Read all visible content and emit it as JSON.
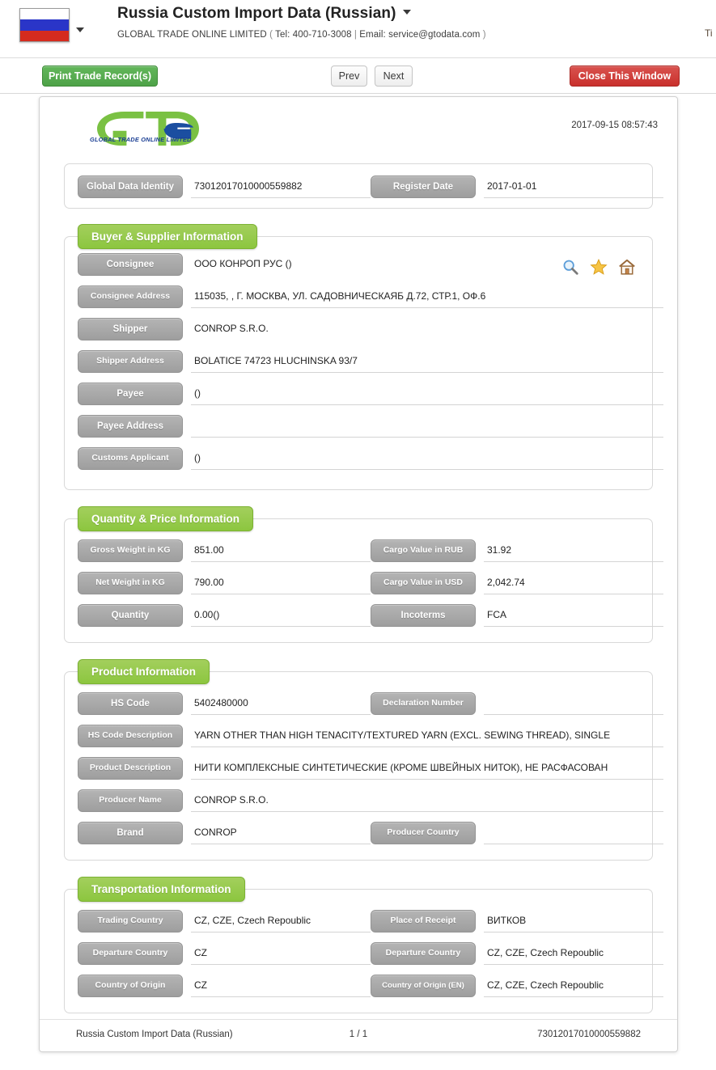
{
  "header": {
    "flag_icon": "russia-flag-icon",
    "title": "Russia Custom Import Data (Russian)",
    "company_name": "GLOBAL TRADE ONLINE LIMITED",
    "company_contact_open": "(",
    "tel_label": "Tel: 400-710-3008",
    "contact_sep": "|",
    "email_label": "Email: service@gtodata.com",
    "company_contact_close": ")",
    "clipped_right_text": "Ti"
  },
  "toolbar": {
    "print_label": "Print Trade Record(s)",
    "prev_label": "Prev",
    "next_label": "Next",
    "close_label": "Close This Window"
  },
  "document": {
    "logo_text": "GTO",
    "logo_subtitle": "GLOBAL TRADE  ONLINE LIMITED",
    "timestamp": "2017-09-15 08:57:43",
    "identity": {
      "global_data_identity_label": "Global Data Identity",
      "global_data_identity_value": "73012017010000559882",
      "register_date_label": "Register Date",
      "register_date_value": "2017-01-01"
    },
    "buyer_supplier": {
      "section_title": "Buyer & Supplier Information",
      "icons": [
        "search-icon",
        "favorite-star-icon",
        "home-icon"
      ],
      "fields": [
        {
          "label": "Consignee",
          "value": "OOO КОНРОП РУС ()"
        },
        {
          "label": "Consignee Address",
          "value": "115035, , Г. МОСКВА, УЛ. САДОВНИЧЕСКАЯБ Д.72, СТР.1, ОФ.6"
        },
        {
          "label": "Shipper",
          "value": "CONROP S.R.O."
        },
        {
          "label": "Shipper Address",
          "value": "BOLATICE 74723 HLUCHINSKA 93/7"
        },
        {
          "label": "Payee",
          "value": "()"
        },
        {
          "label": "Payee Address",
          "value": ""
        },
        {
          "label": "Customs Applicant",
          "value": "()"
        }
      ]
    },
    "quantity_price": {
      "section_title": "Quantity & Price Information",
      "left_fields": [
        {
          "label": "Gross Weight in KG",
          "value": "851.00"
        },
        {
          "label": "Net Weight in KG",
          "value": "790.00"
        },
        {
          "label": "Quantity",
          "value": "0.00()"
        }
      ],
      "right_fields": [
        {
          "label": "Cargo Value in RUB",
          "value": "31.92"
        },
        {
          "label": "Cargo Value in USD",
          "value": "2,042.74"
        },
        {
          "label": "Incoterms",
          "value": "FCA"
        }
      ]
    },
    "product": {
      "section_title": "Product Information",
      "hs_code_label": "HS Code",
      "hs_code_value": "5402480000",
      "declaration_number_label": "Declaration Number",
      "declaration_number_value": "",
      "hs_code_description_label": "HS Code Description",
      "hs_code_description_value": "YARN OTHER THAN HIGH TENACITY/TEXTURED YARN (EXCL. SEWING THREAD), SINGLE",
      "product_description_label": "Product Description",
      "product_description_value": "НИТИ КОМПЛЕКСНЫЕ СИНТЕТИЧЕСКИЕ (КРОМЕ ШВЕЙНЫХ НИТОК), НЕ РАСФАСОВАН",
      "producer_name_label": "Producer Name",
      "producer_name_value": "CONROP S.R.O.",
      "brand_label": "Brand",
      "brand_value": "CONROP",
      "producer_country_label": "Producer Country",
      "producer_country_value": ""
    },
    "transportation": {
      "section_title": "Transportation Information",
      "left_fields": [
        {
          "label": "Trading Country",
          "value": "CZ, CZE, Czech Repoublic"
        },
        {
          "label": "Departure Country",
          "value": "CZ"
        },
        {
          "label": "Country of Origin",
          "value": "CZ"
        }
      ],
      "right_fields": [
        {
          "label": "Place of Receipt",
          "value": "ВИТКОВ"
        },
        {
          "label": "Departure Country",
          "value": "CZ, CZE, Czech Repoublic"
        },
        {
          "label": "Country of Origin (EN)",
          "value": "CZ, CZE, Czech Repoublic"
        }
      ]
    },
    "footer": {
      "left": "Russia Custom Import Data (Russian)",
      "page": "1 / 1",
      "right": "73012017010000559882"
    }
  },
  "colors": {
    "section_green": "#8cc63f",
    "key_gray": "#9e9e9e",
    "print_green": "#4ea248",
    "close_red": "#c9302c",
    "logo_blue": "#1b3f94"
  }
}
